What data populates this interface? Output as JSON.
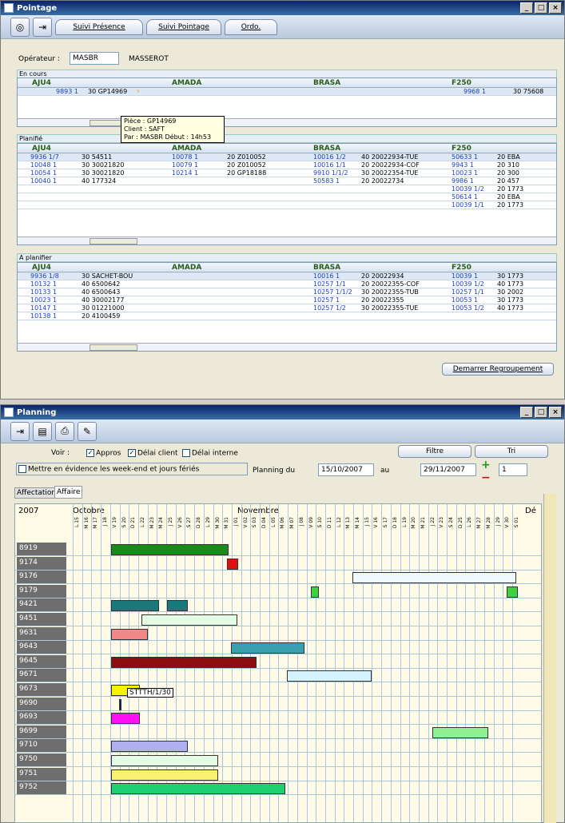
{
  "pointage": {
    "title": "Pointage",
    "tabs": [
      "Suivi Présence",
      "Suivi Pointage",
      "Ordo."
    ],
    "operator_label": "Opérateur :",
    "operator_code": "MASBR",
    "operator_name": "MASSEROT",
    "en_cours": {
      "title": "En cours",
      "headers": [
        "AJU4",
        "AMADA",
        "BRASA",
        "F250"
      ],
      "row": {
        "a": "9893 1",
        "b": "30 GP14969",
        "f": "9968 1",
        "g": "30 75608"
      }
    },
    "tooltip": {
      "line1": "Pièce : GP14969",
      "line2": "Client : SAFT",
      "line3": "Par : MASBR Début : 14h53"
    },
    "planifie": {
      "title": "Planifié",
      "headers": [
        "AJU4",
        "AMADA",
        "BRASA",
        "F250"
      ],
      "rows": [
        [
          "9936 1/7",
          "30 54511",
          "10078 1",
          "20 Z010052",
          "10016 1/2",
          "40 20022934-TUE",
          "50633 1",
          "20 EBA"
        ],
        [
          "10048 1",
          "30 30021820",
          "10079 1",
          "20 Z010052",
          "10016 1/1",
          "20 20022934-COF",
          "9943 1",
          "20 310"
        ],
        [
          "10054 1",
          "30 30021820",
          "10214 1",
          "20 GP18188",
          "9910 1/1/2",
          "30 20022354-TUE",
          "10023 1",
          "20 300"
        ],
        [
          "10040 1",
          "40 177324",
          "",
          "",
          "50583 1",
          "20 20022734",
          "9986 1",
          "20 457"
        ],
        [
          "",
          "",
          "",
          "",
          "",
          "",
          "10039 1/2",
          "20 1773"
        ],
        [
          "",
          "",
          "",
          "",
          "",
          "",
          "50614 1",
          "20 EBA"
        ],
        [
          "",
          "",
          "",
          "",
          "",
          "",
          "10039 1/1",
          "20 1773"
        ]
      ]
    },
    "a_planifier": {
      "title": "A planifier",
      "headers": [
        "AJU4",
        "AMADA",
        "BRASA",
        "F250"
      ],
      "rows": [
        [
          "9936 1/8",
          "30 SACHET-BOU",
          "10016 1",
          "20 20022934",
          "10039 1",
          "30 1773"
        ],
        [
          "10132 1",
          "40 6500642",
          "10257 1/1",
          "20 20022355-COF",
          "10039 1/2",
          "40 1773"
        ],
        [
          "10133 1",
          "40 6500643",
          "10257 1/1/2",
          "30 20022355-TUB",
          "10257 1/1",
          "30 2002"
        ],
        [
          "10023 1",
          "40 30002177",
          "10257 1",
          "20 20022355",
          "10053 1",
          "30 1773"
        ],
        [
          "10147 1",
          "30 01221000",
          "10257 1/2",
          "30 20022355-TUE",
          "10053 1/2",
          "40 1773"
        ],
        [
          "10138 1",
          "20 4100459",
          "",
          "",
          "",
          ""
        ]
      ]
    },
    "regroup_button": "Demarrer Regroupement"
  },
  "planning": {
    "title": "Planning",
    "voir_label": "Voir :",
    "appros": "Appros",
    "delai_client": "Délai client",
    "delai_interne": "Délai interne",
    "filtre": "Filtre",
    "tri": "Tri",
    "weekend": "Mettre en évidence les week-end et jours fériés",
    "planning_du": "Planning du",
    "date_from": "15/10/2007",
    "au": "au",
    "date_to": "29/11/2007",
    "step": "1",
    "tabs": [
      "Affectation",
      "Affaire"
    ],
    "year": "2007",
    "month1": "Octobre",
    "month2": "Novembre",
    "month3": "Dé",
    "days": [
      "L 15",
      "M 16",
      "M 17",
      "J 18",
      "V 19",
      "S 20",
      "D 21",
      "L 22",
      "M 23",
      "M 24",
      "J 25",
      "V 26",
      "S 27",
      "D 28",
      "L 29",
      "M 30",
      "M 31",
      "J 01",
      "V 02",
      "S 03",
      "D 04",
      "L 05",
      "M 06",
      "M 07",
      "J 08",
      "V 09",
      "S 10",
      "D 11",
      "L 12",
      "M 13",
      "M 14",
      "J 15",
      "V 16",
      "S 17",
      "D 18",
      "L 19",
      "M 20",
      "M 21",
      "J 22",
      "V 23",
      "S 24",
      "D 25",
      "L 26",
      "M 27",
      "M 28",
      "J 29",
      "V 30",
      "S 01"
    ],
    "rows": [
      "8919",
      "9174",
      "9176",
      "9179",
      "9421",
      "9451",
      "9631",
      "9643",
      "9645",
      "9671",
      "9673",
      "9690",
      "9693",
      "9699",
      "9710",
      "9750",
      "9751",
      "9752"
    ],
    "bar_tooltip": "STTTH/1/30"
  }
}
